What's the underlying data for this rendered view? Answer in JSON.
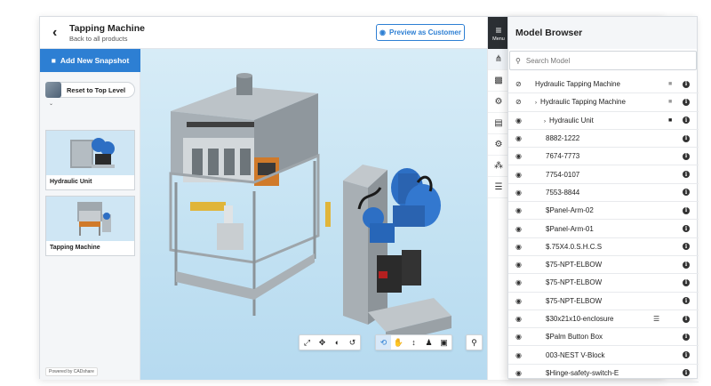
{
  "header": {
    "title": "Tapping Machine",
    "subtitle": "Back to all products",
    "preview_label": "Preview as Customer"
  },
  "menu": {
    "label": "Menu"
  },
  "snapshots": {
    "add_label": "Add New Snapshot",
    "reset_label": "Reset to Top Level",
    "items": [
      {
        "label": "Hydraulic Unit"
      },
      {
        "label": "Tapping Machine"
      }
    ]
  },
  "powered_by": "Powered by CADshare",
  "model_browser": {
    "title": "Model Browser",
    "search_placeholder": "Search Model",
    "rows": [
      {
        "name": "Hydraulic Tapping Machine",
        "indent": 0,
        "caret": false,
        "eye_off": true,
        "lock": "light",
        "list": false
      },
      {
        "name": "Hydraulic Tapping Machine",
        "indent": 1,
        "caret": true,
        "eye_off": true,
        "lock": "light",
        "list": false
      },
      {
        "name": "Hydraulic Unit",
        "indent": 2,
        "caret": true,
        "eye_off": false,
        "lock": "dark",
        "list": false
      },
      {
        "name": "8882-1222",
        "indent": 3,
        "caret": false,
        "eye_off": false,
        "lock": "",
        "list": false
      },
      {
        "name": "7674-7773",
        "indent": 3,
        "caret": false,
        "eye_off": false,
        "lock": "",
        "list": false
      },
      {
        "name": "7754-0107",
        "indent": 3,
        "caret": false,
        "eye_off": false,
        "lock": "",
        "list": false
      },
      {
        "name": "7553-8844",
        "indent": 3,
        "caret": false,
        "eye_off": false,
        "lock": "",
        "list": false
      },
      {
        "name": "$Panel-Arm-02",
        "indent": 3,
        "caret": false,
        "eye_off": false,
        "lock": "",
        "list": false
      },
      {
        "name": "$Panel-Arm-01",
        "indent": 3,
        "caret": false,
        "eye_off": false,
        "lock": "",
        "list": false
      },
      {
        "name": "$.75X4.0.S.H.C.S",
        "indent": 3,
        "caret": false,
        "eye_off": false,
        "lock": "",
        "list": false
      },
      {
        "name": "$75-NPT-ELBOW",
        "indent": 3,
        "caret": false,
        "eye_off": false,
        "lock": "",
        "list": false
      },
      {
        "name": "$75-NPT-ELBOW",
        "indent": 3,
        "caret": false,
        "eye_off": false,
        "lock": "",
        "list": false
      },
      {
        "name": "$75-NPT-ELBOW",
        "indent": 3,
        "caret": false,
        "eye_off": false,
        "lock": "",
        "list": false
      },
      {
        "name": "$30x21x10-enclosure",
        "indent": 3,
        "caret": false,
        "eye_off": false,
        "lock": "",
        "list": true
      },
      {
        "name": "$Palm Button Box",
        "indent": 3,
        "caret": false,
        "eye_off": false,
        "lock": "",
        "list": false
      },
      {
        "name": "003-NEST V-Block",
        "indent": 3,
        "caret": false,
        "eye_off": false,
        "lock": "",
        "list": false
      },
      {
        "name": "$Hinge-safety-switch-E",
        "indent": 3,
        "caret": false,
        "eye_off": false,
        "lock": "",
        "list": false
      }
    ]
  }
}
